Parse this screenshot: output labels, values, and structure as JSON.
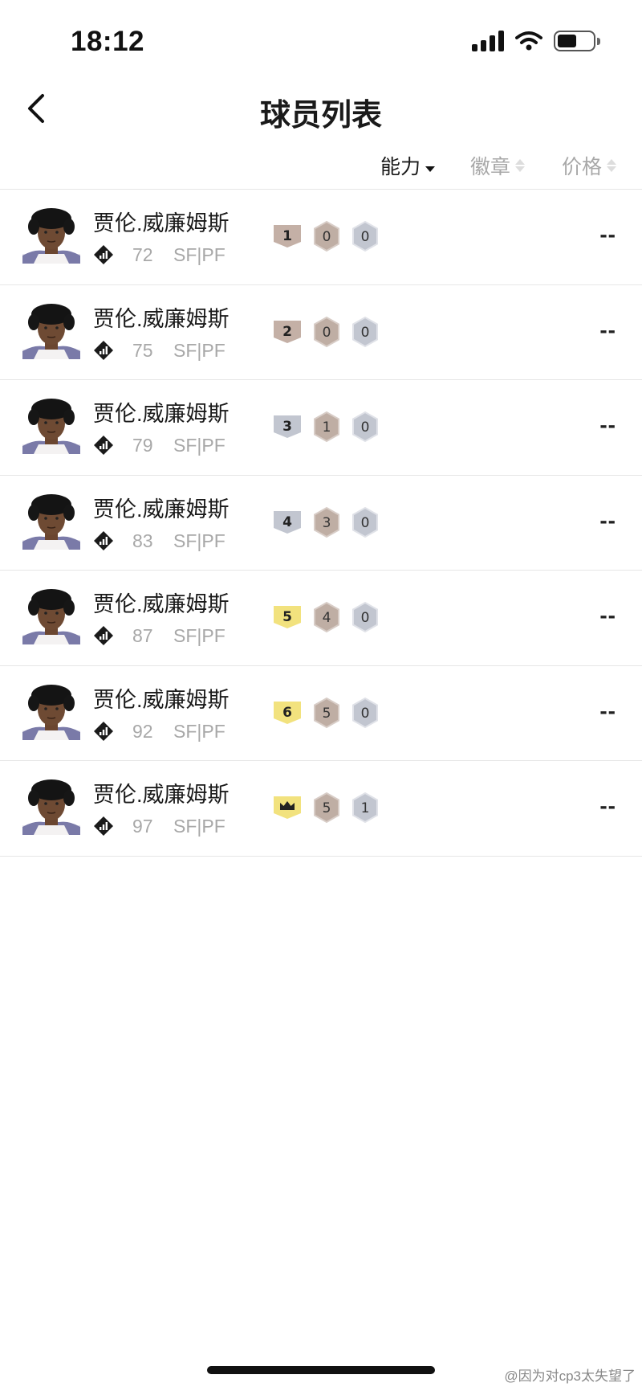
{
  "status_bar": {
    "time": "18:12"
  },
  "nav": {
    "title": "球员列表"
  },
  "sort": {
    "ability": "能力",
    "badges": "徽章",
    "price": "价格"
  },
  "players": [
    {
      "name": "贾伦.威廉姆斯",
      "ovr": "72",
      "position": "SF|PF",
      "level": "1",
      "badge_a": "0",
      "badge_b": "0",
      "price": "--"
    },
    {
      "name": "贾伦.威廉姆斯",
      "ovr": "75",
      "position": "SF|PF",
      "level": "2",
      "badge_a": "0",
      "badge_b": "0",
      "price": "--"
    },
    {
      "name": "贾伦.威廉姆斯",
      "ovr": "79",
      "position": "SF|PF",
      "level": "3",
      "badge_a": "1",
      "badge_b": "0",
      "price": "--"
    },
    {
      "name": "贾伦.威廉姆斯",
      "ovr": "83",
      "position": "SF|PF",
      "level": "4",
      "badge_a": "3",
      "badge_b": "0",
      "price": "--"
    },
    {
      "name": "贾伦.威廉姆斯",
      "ovr": "87",
      "position": "SF|PF",
      "level": "5",
      "badge_a": "4",
      "badge_b": "0",
      "price": "--"
    },
    {
      "name": "贾伦.威廉姆斯",
      "ovr": "92",
      "position": "SF|PF",
      "level": "6",
      "badge_a": "5",
      "badge_b": "0",
      "price": "--"
    },
    {
      "name": "贾伦.威廉姆斯",
      "ovr": "97",
      "position": "SF|PF",
      "level": "crown",
      "badge_a": "5",
      "badge_b": "1",
      "price": "--"
    }
  ],
  "colors": {
    "level_bronze": "#c4b0a6",
    "level_silver": "#c2c6d0",
    "level_gold": "#f2e27e",
    "badge_a": "#bfaea4",
    "badge_b": "#c2c6d0"
  },
  "watermark": "@因为对cp3太失望了"
}
